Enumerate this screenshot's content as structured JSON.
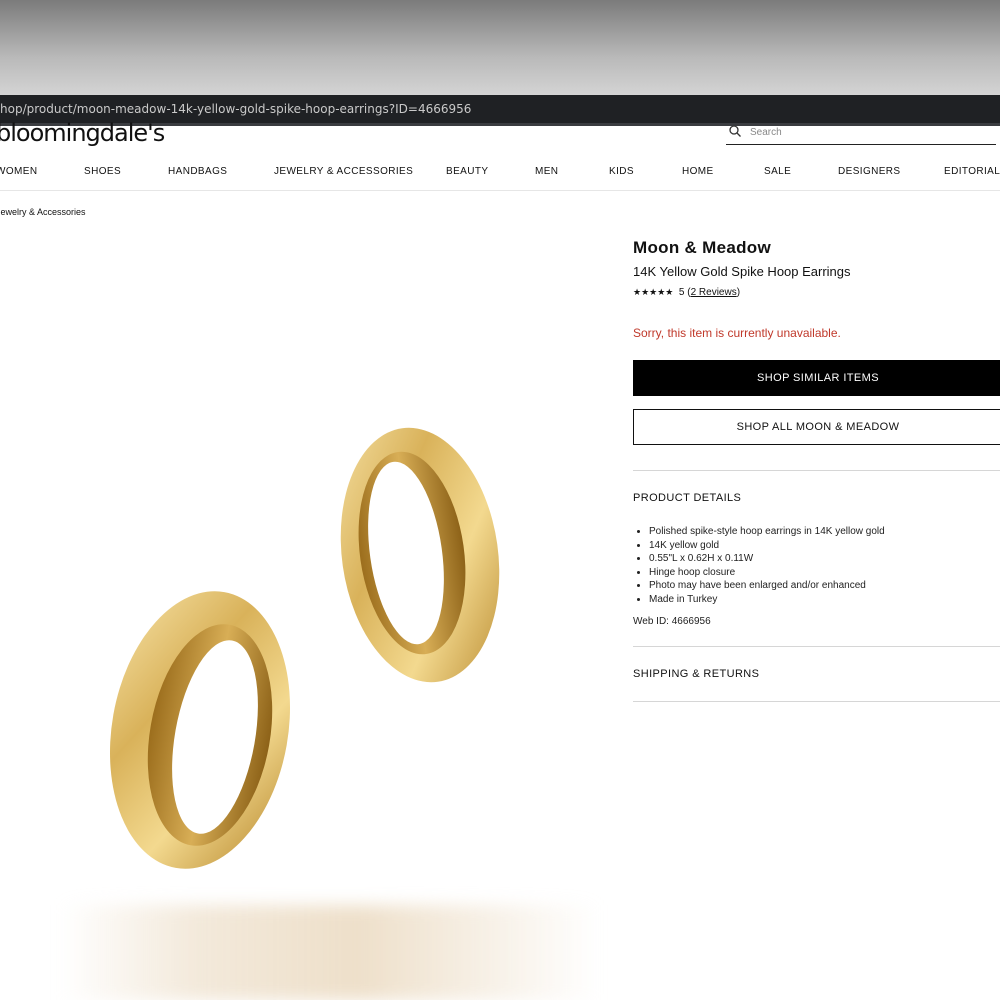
{
  "browser": {
    "url": "hop/product/moon-meadow-14k-yellow-gold-spike-hoop-earrings?ID=4666956"
  },
  "header": {
    "logo_text": "bloomingdale's",
    "search_placeholder": "Search",
    "nav": [
      "WOMEN",
      "SHOES",
      "HANDBAGS",
      "JEWELRY & ACCESSORIES",
      "BEAUTY",
      "MEN",
      "KIDS",
      "HOME",
      "SALE",
      "DESIGNERS",
      "EDITORIAL"
    ]
  },
  "breadcrumb": "Jewelry & Accessories",
  "product": {
    "brand": "Moon & Meadow",
    "title": "14K Yellow Gold Spike Hoop Earrings",
    "stars_display": "★★★★★",
    "rating": "5",
    "reviews_label": "2 Reviews",
    "availability_message": "Sorry, this item is currently unavailable.",
    "primary_button": "SHOP SIMILAR ITEMS",
    "secondary_button": "SHOP ALL MOON & MEADOW",
    "details_heading": "PRODUCT DETAILS",
    "details": [
      "Polished spike-style hoop earrings in 14K yellow gold",
      "14K yellow gold",
      "0.55\"L x 0.62H x 0.11W",
      "Hinge hoop closure",
      "Photo may have been enlarged and/or enhanced",
      "Made in Turkey"
    ],
    "web_id": "Web ID: 4666956",
    "shipping_heading": "SHIPPING & RETURNS"
  },
  "colors": {
    "alert": "#c0392b",
    "primary_button_bg": "#000000",
    "gold": "#d8b35a"
  }
}
